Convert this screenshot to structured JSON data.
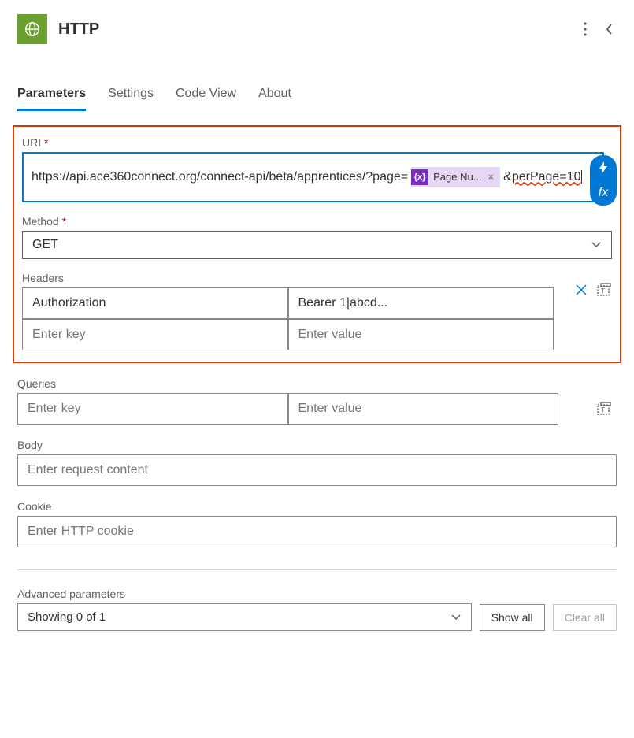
{
  "header": {
    "title": "HTTP"
  },
  "tabs": [
    {
      "label": "Parameters",
      "active": true
    },
    {
      "label": "Settings",
      "active": false
    },
    {
      "label": "Code View",
      "active": false
    },
    {
      "label": "About",
      "active": false
    }
  ],
  "uri": {
    "label": "URI",
    "required": true,
    "text_before": "https://api.ace360connect.org/connect-api/beta/apprentices/?page=",
    "chip_label": "Page Nu...",
    "text_after_amp": "&",
    "text_after": "perPage=10"
  },
  "method": {
    "label": "Method",
    "required": true,
    "value": "GET"
  },
  "headers": {
    "label": "Headers",
    "rows": [
      {
        "key": "Authorization",
        "value": "Bearer 1|abcd..."
      }
    ],
    "placeholder_key": "Enter key",
    "placeholder_value": "Enter value"
  },
  "queries": {
    "label": "Queries",
    "placeholder_key": "Enter key",
    "placeholder_value": "Enter value"
  },
  "body": {
    "label": "Body",
    "placeholder": "Enter request content"
  },
  "cookie": {
    "label": "Cookie",
    "placeholder": "Enter HTTP cookie"
  },
  "advanced": {
    "label": "Advanced parameters",
    "showing": "Showing 0 of 1",
    "show_all": "Show all",
    "clear_all": "Clear all"
  },
  "fx_label": "fx"
}
